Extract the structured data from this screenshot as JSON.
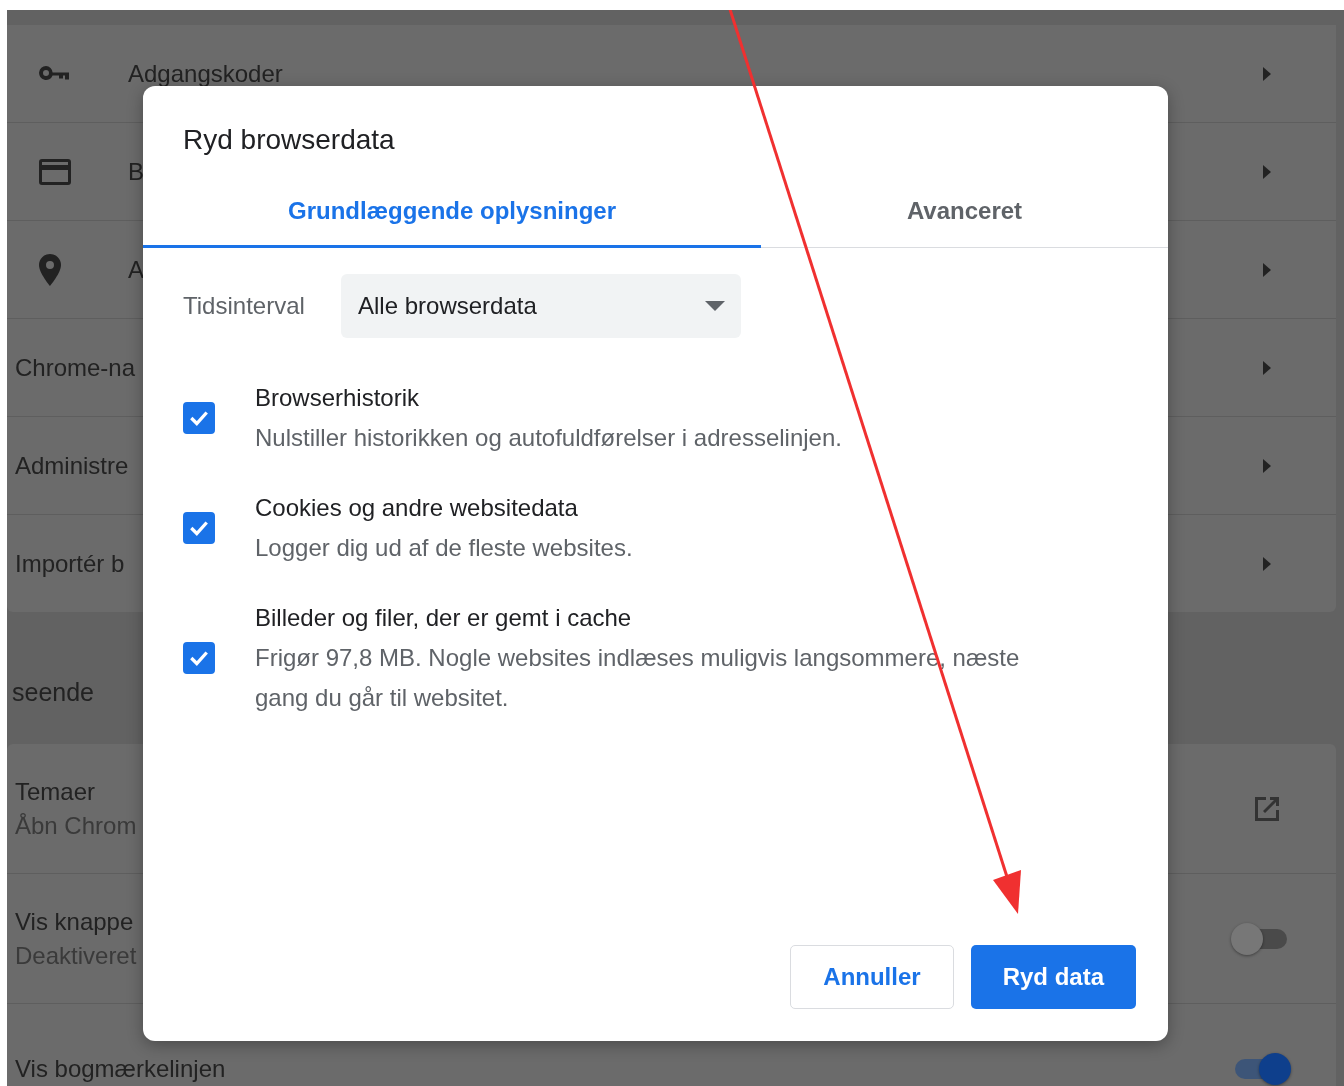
{
  "settings": {
    "rows": [
      {
        "kind": "icon",
        "label": "Adgangskoder"
      },
      {
        "kind": "icon",
        "label": "B"
      },
      {
        "kind": "icon",
        "label": "A"
      },
      {
        "kind": "plain",
        "label": "Chrome-na"
      },
      {
        "kind": "plain",
        "label": "Administre"
      },
      {
        "kind": "plain",
        "label": "Importér b"
      }
    ],
    "section_heading": "seende",
    "appearance_rows": [
      {
        "kind": "link",
        "title": "Temaer",
        "subtitle": "Åbn Chrom"
      },
      {
        "kind": "toggle",
        "title": "Vis knappe",
        "subtitle": "Deaktiveret",
        "on": false
      },
      {
        "kind": "toggle",
        "title": "Vis bogmærkelinjen",
        "on": true
      }
    ]
  },
  "dialog": {
    "title": "Ryd browserdata",
    "tabs": [
      {
        "label": "Grundlæggende oplysninger",
        "selected": true
      },
      {
        "label": "Avanceret",
        "selected": false
      }
    ],
    "time_range": {
      "label": "Tidsinterval",
      "value": "Alle browserdata"
    },
    "items": [
      {
        "title": "Browserhistorik",
        "description": "Nulstiller historikken og autofuldførelser i adresselinjen.",
        "checked": true
      },
      {
        "title": "Cookies og andre websitedata",
        "description": "Logger dig ud af de fleste websites.",
        "checked": true
      },
      {
        "title": "Billeder og filer, der er gemt i cache",
        "description": "Frigør 97,8 MB. Nogle websites indlæses muligvis langsommere, næste gang du går til websitet.",
        "checked": true
      }
    ],
    "buttons": [
      {
        "label": "Annuller",
        "kind": "secondary"
      },
      {
        "label": "Ryd data",
        "kind": "primary"
      }
    ]
  }
}
